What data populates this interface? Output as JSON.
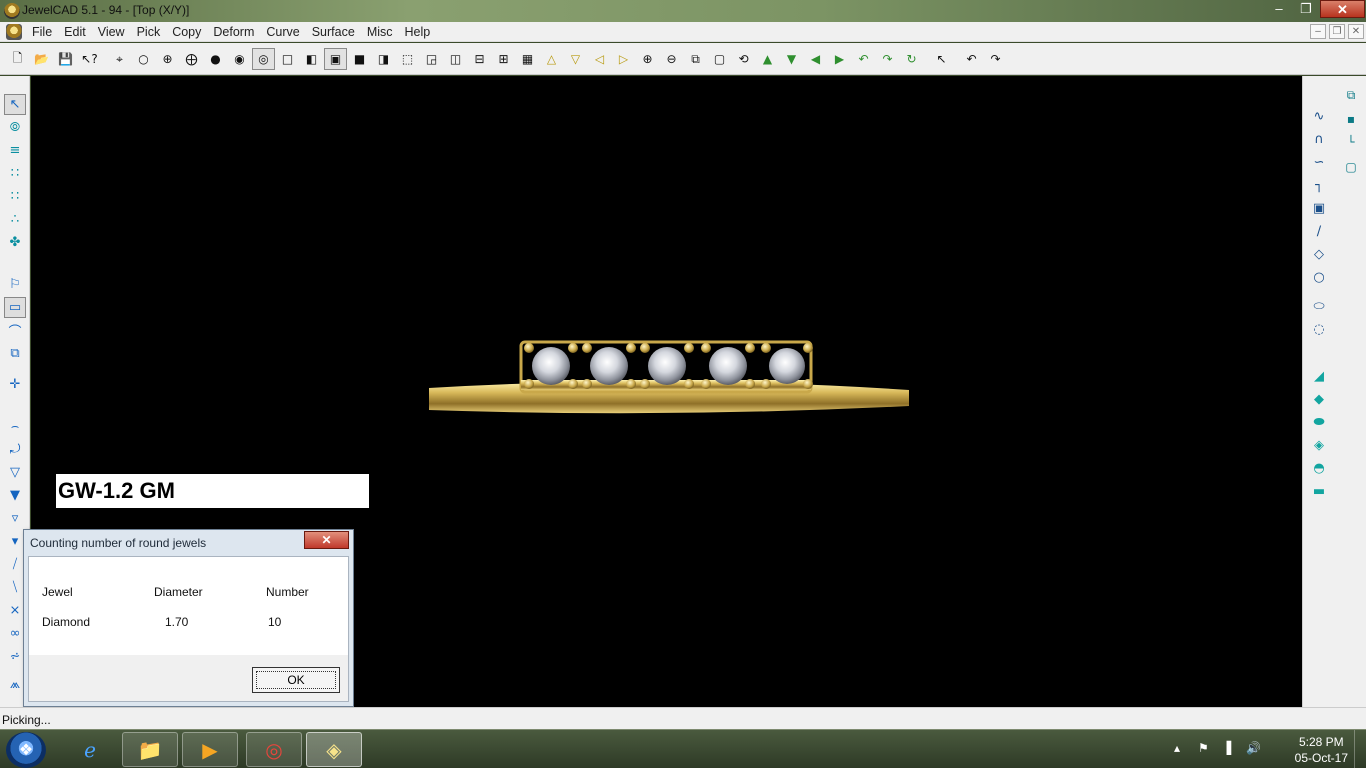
{
  "window": {
    "title": "JewelCAD 5.1 - 94 - [Top (X/Y)]"
  },
  "menu": [
    "File",
    "Edit",
    "View",
    "Pick",
    "Copy",
    "Deform",
    "Curve",
    "Surface",
    "Misc",
    "Help"
  ],
  "icons": {
    "top_toolbar": [
      "new-file-icon",
      "open-folder-icon",
      "save-icon",
      "help-pointer-icon",
      "crosshair-icon",
      "circle-icon",
      "target-icon",
      "target-filled-icon",
      "dot-icon",
      "dot-ring-icon",
      "render-mode-icon",
      "view-square-icon",
      "view-left-icon",
      "view-front-icon",
      "view-top-icon",
      "view-right-icon",
      "view-frame-icon",
      "view-tl-icon",
      "view-split-v-icon",
      "view-split-h-icon",
      "view-quad-icon",
      "view-grid-icon",
      "triangle-up-icon",
      "triangle-down-icon",
      "triangle-left-icon",
      "triangle-right-icon",
      "zoom-in-icon",
      "zoom-out-icon",
      "zoom-window-icon",
      "zoom-box-icon",
      "zoom-all-icon",
      "arrow-up-icon",
      "arrow-down-icon",
      "arrow-left-icon",
      "arrow-right-icon",
      "rotate-left-icon",
      "rotate-right-icon",
      "rotate-free-icon",
      "select-arrow-icon",
      "undo-icon",
      "redo-icon"
    ]
  },
  "canvas": {
    "label_text": "GW-1.2 GM",
    "metal_color": "#c9a84a",
    "gem_color": "#e8e8ee",
    "gem_count": 5
  },
  "dialog": {
    "title": "Counting number of round jewels",
    "close_label": "✕",
    "columns": [
      "Jewel",
      "Diameter",
      "Number"
    ],
    "rows": [
      {
        "jewel": "Diamond",
        "diameter": "1.70",
        "number": "10"
      }
    ],
    "ok_label": "OK"
  },
  "status": {
    "text": "Picking..."
  },
  "taskbar": {
    "time": "5:28 PM",
    "date": "05-Oct-17"
  }
}
